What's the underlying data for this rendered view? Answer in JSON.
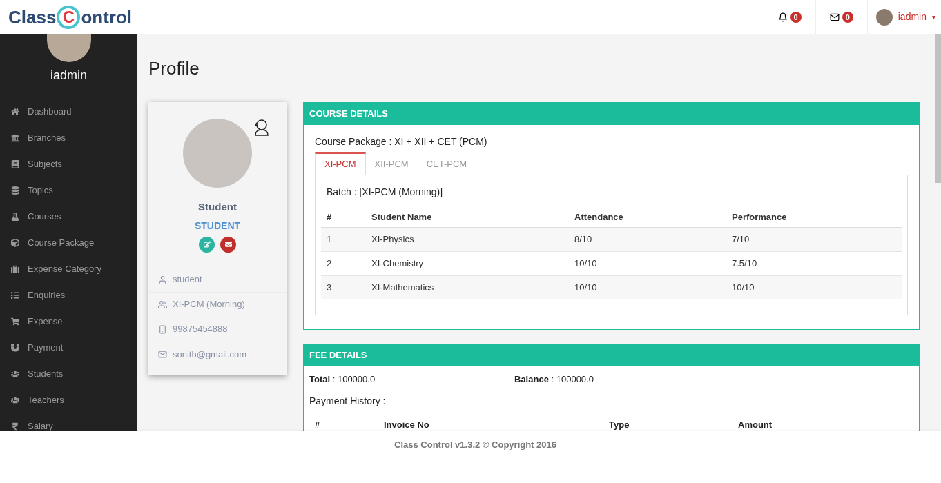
{
  "logo": {
    "before": "Class",
    "letter": "C",
    "after": "ontrol"
  },
  "topbar": {
    "notifications": "0",
    "messages": "0",
    "user": "iadmin",
    "caret": "▾"
  },
  "sidebar": {
    "user": "iadmin",
    "items": [
      {
        "label": "Dashboard",
        "selected": false
      },
      {
        "label": "Branches",
        "selected": false
      },
      {
        "label": "Subjects",
        "selected": false
      },
      {
        "label": "Topics",
        "selected": false
      },
      {
        "label": "Courses",
        "selected": false
      },
      {
        "label": "Course Package",
        "selected": false
      },
      {
        "label": "Expense Category",
        "selected": false
      },
      {
        "label": "Enquiries",
        "selected": false
      },
      {
        "label": "Expense",
        "selected": false
      },
      {
        "label": "Payment",
        "selected": false
      },
      {
        "label": "Students",
        "selected": false
      },
      {
        "label": "Teachers",
        "selected": false
      },
      {
        "label": "Salary",
        "selected": false
      }
    ]
  },
  "page_title": "Profile",
  "profile": {
    "name": "Student",
    "role": "STUDENT",
    "details": [
      {
        "kind": "user",
        "text": "student",
        "link": false
      },
      {
        "kind": "batch",
        "text": "XI-PCM (Morning)",
        "link": true
      },
      {
        "kind": "phone",
        "text": "99875454888",
        "link": false
      },
      {
        "kind": "email",
        "text": "sonith@gmail.com",
        "link": false
      }
    ]
  },
  "course_details": {
    "title": "COURSE DETAILS",
    "package": "Course Package : XI + XII + CET (PCM)",
    "tabs": [
      {
        "label": "XI-PCM",
        "selected": true
      },
      {
        "label": "XII-PCM",
        "selected": false
      },
      {
        "label": "CET-PCM",
        "selected": false
      }
    ],
    "batch": "Batch : [XI-PCM (Morning)]",
    "columns": [
      "#",
      "Student Name",
      "Attendance",
      "Performance"
    ],
    "rows": [
      [
        "1",
        "XI-Physics",
        "8/10",
        "7/10"
      ],
      [
        "2",
        "XI-Chemistry",
        "10/10",
        "7.5/10"
      ],
      [
        "3",
        "XI-Mathematics",
        "10/10",
        "10/10"
      ]
    ]
  },
  "fee_details": {
    "title": "FEE DETAILS",
    "total_label": "Total",
    "total": " : 100000.0",
    "balance_label": "Balance",
    "balance": " : 100000.0",
    "history": "Payment History :",
    "columns": [
      "#",
      "Invoice No",
      "Type",
      "Amount"
    ]
  },
  "footer": "Class Control v1.3.2 © Copyright 2016"
}
